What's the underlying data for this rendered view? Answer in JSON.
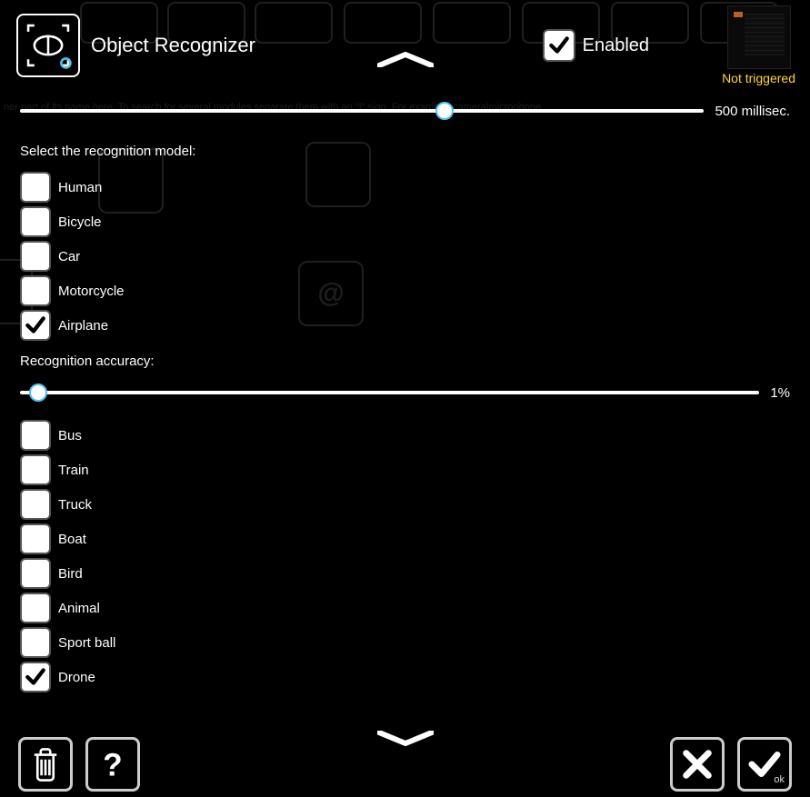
{
  "header": {
    "title": "Object Recognizer",
    "enabled_label": "Enabled",
    "enabled_checked": true,
    "status_text": "Not triggered"
  },
  "slider1": {
    "label": "500 millisec.",
    "position_pct": 62
  },
  "model_label": "Select the recognition model:",
  "models_a": [
    {
      "label": "Human",
      "checked": false
    },
    {
      "label": "Bicycle",
      "checked": false
    },
    {
      "label": "Car",
      "checked": false
    },
    {
      "label": "Motorcycle",
      "checked": false
    },
    {
      "label": "Airplane",
      "checked": true
    }
  ],
  "accuracy_label": "Recognition accuracy:",
  "slider2": {
    "label": "1%",
    "position_pct": 2.5
  },
  "models_b": [
    {
      "label": "Bus",
      "checked": false
    },
    {
      "label": "Train",
      "checked": false
    },
    {
      "label": "Truck",
      "checked": false
    },
    {
      "label": "Boat",
      "checked": false
    },
    {
      "label": "Bird",
      "checked": false
    },
    {
      "label": "Animal",
      "checked": false
    },
    {
      "label": "Sport ball",
      "checked": false
    },
    {
      "label": "Drone",
      "checked": true
    }
  ],
  "bg_hint": "ner part of its name here. To search for several modules separate them with an \"|\" sign. For example: camera|microphone",
  "footer": {
    "ok_label": "ok"
  }
}
